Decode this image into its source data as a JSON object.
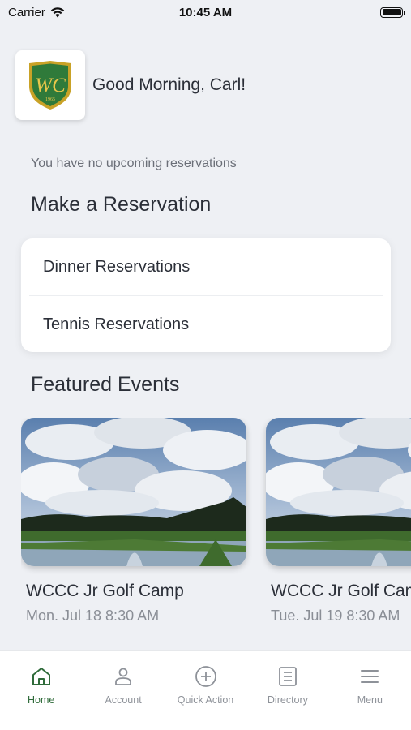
{
  "status_bar": {
    "carrier": "Carrier",
    "time": "10:45 AM"
  },
  "header": {
    "logo_text": "WC",
    "logo_year": "1965",
    "greeting": "Good Morning, Carl!"
  },
  "reservations": {
    "empty_message": "You have no upcoming reservations",
    "section_title": "Make a Reservation",
    "items": [
      {
        "label": "Dinner Reservations"
      },
      {
        "label": "Tennis Reservations"
      }
    ]
  },
  "featured": {
    "section_title": "Featured Events",
    "events": [
      {
        "title": "WCCC Jr Golf Camp",
        "date": "Mon. Jul 18 8:30 AM"
      },
      {
        "title": "WCCC Jr Golf Camp",
        "date": "Tue. Jul 19 8:30 AM"
      }
    ]
  },
  "tabbar": {
    "active": "Home",
    "active_color": "#2f6b3a",
    "items": [
      {
        "label": "Home",
        "icon": "home-icon"
      },
      {
        "label": "Account",
        "icon": "person-icon"
      },
      {
        "label": "Quick Action",
        "icon": "plus-circle-icon"
      },
      {
        "label": "Directory",
        "icon": "list-icon"
      },
      {
        "label": "Menu",
        "icon": "hamburger-icon"
      }
    ]
  }
}
